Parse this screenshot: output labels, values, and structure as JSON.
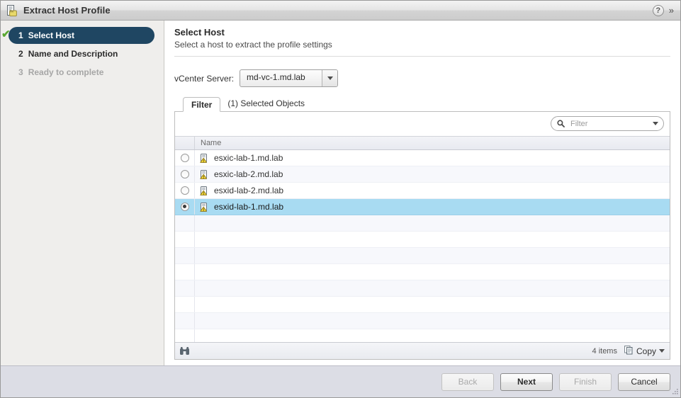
{
  "window": {
    "title": "Extract Host Profile",
    "icon": "host-profile-icon",
    "help_icon": "?",
    "collapse_icon": "»"
  },
  "sidebar": {
    "steps": [
      {
        "num": "1",
        "label": "Select Host",
        "state": "active",
        "check": "✔"
      },
      {
        "num": "2",
        "label": "Name and Description",
        "state": "todo",
        "check": ""
      },
      {
        "num": "3",
        "label": "Ready to complete",
        "state": "disabled",
        "check": ""
      }
    ]
  },
  "content": {
    "title": "Select Host",
    "subtitle": "Select a host to extract the profile settings",
    "vcenter": {
      "label": "vCenter Server:",
      "value": "md-vc-1.md.lab"
    },
    "tabs": [
      {
        "label": "Filter",
        "state": "active"
      },
      {
        "label": "(1) Selected Objects",
        "state": "inactive"
      }
    ],
    "search": {
      "placeholder": "Filter",
      "value": ""
    },
    "table": {
      "columns": [
        "Name"
      ],
      "rows": [
        {
          "name": "esxic-lab-1.md.lab",
          "selected": false
        },
        {
          "name": "esxic-lab-2.md.lab",
          "selected": false
        },
        {
          "name": "esxid-lab-2.md.lab",
          "selected": false
        },
        {
          "name": "esxid-lab-1.md.lab",
          "selected": true
        }
      ],
      "empty_row_count": 8
    },
    "status": {
      "items_count": "4 items",
      "copy_label": "Copy"
    }
  },
  "footer": {
    "buttons": [
      {
        "label": "Back",
        "state": "disabled"
      },
      {
        "label": "Next",
        "state": "primary"
      },
      {
        "label": "Finish",
        "state": "disabled"
      },
      {
        "label": "Cancel",
        "state": "normal"
      }
    ]
  },
  "colors": {
    "step_active_bg": "#1f4662",
    "check_green": "#5aa832",
    "row_selected_bg": "#a8dbf2",
    "footer_bg": "#dcdde5",
    "sidebar_bg": "#efeeec"
  }
}
